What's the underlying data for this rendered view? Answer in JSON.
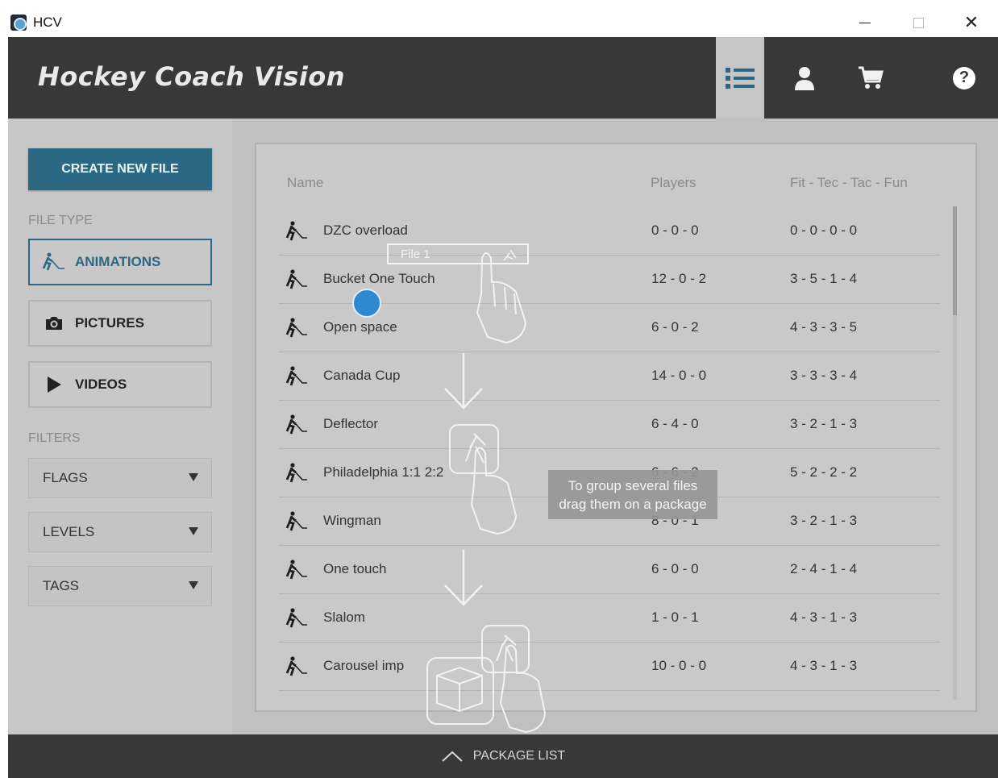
{
  "window": {
    "title": "HCV",
    "controls": [
      "minimize",
      "maximize",
      "close"
    ]
  },
  "header": {
    "brand": "Hockey Coach Vision",
    "icons": [
      "list-icon",
      "user-icon",
      "cart-icon",
      "help-icon"
    ],
    "help_glyph": "?"
  },
  "sidebar": {
    "create_button": "CREATE NEW FILE",
    "file_type_label": "FILE TYPE",
    "file_types": [
      {
        "label": "ANIMATIONS",
        "icon": "skater-icon",
        "active": true
      },
      {
        "label": "PICTURES",
        "icon": "camera-icon",
        "active": false
      },
      {
        "label": "VIDEOS",
        "icon": "play-icon",
        "active": false
      }
    ],
    "filters_label": "FILTERS",
    "filters": [
      "FLAGS",
      "LEVELS",
      "TAGS"
    ]
  },
  "table": {
    "columns": {
      "name": "Name",
      "players": "Players",
      "scores": "Fit - Tec - Tac - Fun"
    },
    "rows": [
      {
        "name": "DZC overload",
        "players": "0 - 0 - 0",
        "scores": "0 - 0 - 0 - 0"
      },
      {
        "name": "Bucket One Touch",
        "players": "12 - 0 - 2",
        "scores": "3 - 5 - 1 - 4"
      },
      {
        "name": "Open space",
        "players": "6 - 0 - 2",
        "scores": "4 - 3 - 3 - 5"
      },
      {
        "name": "Canada Cup",
        "players": "14 - 0 - 0",
        "scores": "3 - 3 - 3 - 4"
      },
      {
        "name": "Deflector",
        "players": "6 - 4 - 0",
        "scores": "3 - 2 - 1 - 3"
      },
      {
        "name": "Philadelphia 1:1 2:2",
        "players": "6 - 6 - 2",
        "scores": "5 - 2 - 2 - 2"
      },
      {
        "name": "Wingman",
        "players": "8 - 0 - 1",
        "scores": "3 - 2 - 1 - 3"
      },
      {
        "name": "One touch",
        "players": "6 - 0 - 0",
        "scores": "2 - 4 - 1 - 4"
      },
      {
        "name": "Slalom",
        "players": "1 - 0 - 1",
        "scores": "4 - 3 - 1 - 3"
      },
      {
        "name": "Carousel imp",
        "players": "10 - 0 - 0",
        "scores": "4 - 3 - 1 - 3"
      }
    ]
  },
  "tutorial": {
    "drag_label": "File 1",
    "tooltip_line1": "To group several files",
    "tooltip_line2": "drag them on a package"
  },
  "footer": {
    "label": "PACKAGE LIST"
  },
  "colors": {
    "accent": "#2b6883",
    "header_bg": "#383838",
    "drag_dot": "#2e8bd1"
  }
}
